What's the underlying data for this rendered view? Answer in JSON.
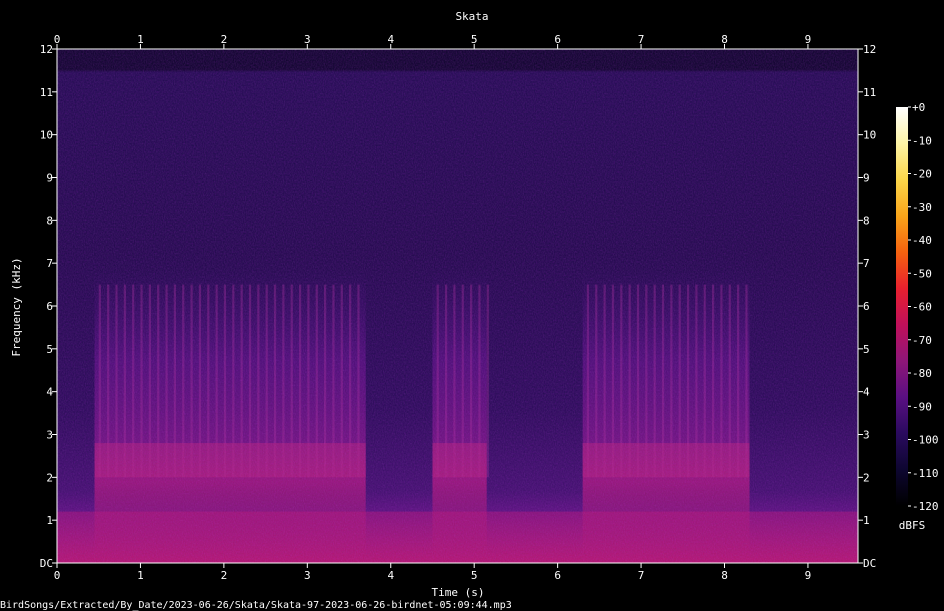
{
  "chart_data": {
    "type": "heatmap",
    "title": "Skata",
    "xlabel": "Time (s)",
    "ylabel": "Frequency (kHz)",
    "xlim": [
      0,
      9.6
    ],
    "ylim": [
      0,
      12
    ],
    "x_ticks": [
      "0",
      "1",
      "2",
      "3",
      "4",
      "5",
      "6",
      "7",
      "8",
      "9"
    ],
    "y_ticks": [
      "DC",
      "1",
      "2",
      "3",
      "4",
      "5",
      "6",
      "7",
      "8",
      "9",
      "10",
      "11",
      "12"
    ],
    "colorbar": {
      "label": "dBFS",
      "range": [
        -120,
        0
      ],
      "ticks": [
        "+0",
        "-10",
        "-20",
        "-30",
        "-40",
        "-50",
        "-60",
        "-70",
        "-80",
        "-90",
        "-100",
        "-110",
        "-120"
      ],
      "colors": [
        "#000000",
        "#0d0630",
        "#2a0a5e",
        "#5a0f82",
        "#8e1678",
        "#c0105a",
        "#e8202e",
        "#f5620f",
        "#f9a51a",
        "#fbd64a",
        "#fdf4a6",
        "#ffffff"
      ]
    },
    "call_segments_s": [
      [
        0.45,
        3.7
      ],
      [
        4.5,
        5.15
      ],
      [
        6.3,
        8.3
      ]
    ],
    "background_band_khz": [
      0,
      1.2
    ],
    "call_energy_band_khz": [
      2.0,
      2.8
    ],
    "harmonic_extent_khz": 6.8,
    "noise_top_khz": 11.5
  },
  "footer": {
    "file_path": "BirdSongs/Extracted/By_Date/2023-06-26/Skata/Skata-97-2023-06-26-birdnet-05:09:44.mp3"
  }
}
